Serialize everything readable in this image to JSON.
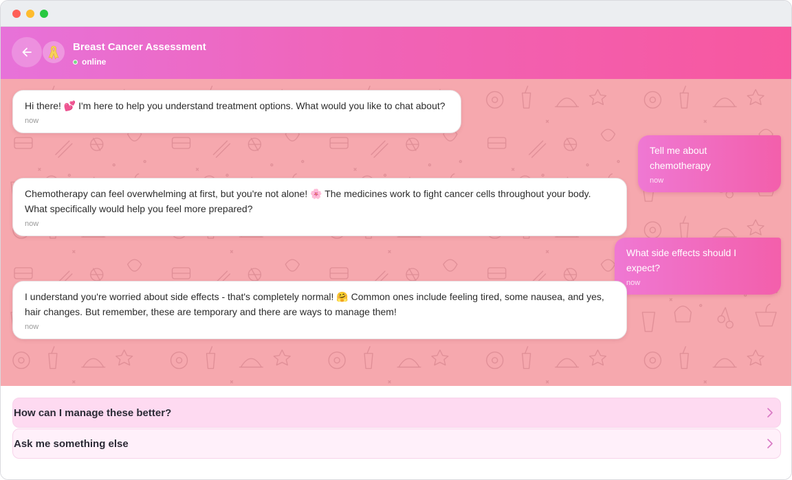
{
  "header": {
    "title": "Breast Cancer Assessment",
    "status": "online",
    "back_icon": "arrow-left-icon",
    "avatar_icon": "awareness-ribbon-icon"
  },
  "messages": [
    {
      "sender": "bot",
      "text": "Hi there! 💕 I'm here to help you understand treatment options. What would you like to chat about?",
      "time": "now"
    },
    {
      "sender": "user",
      "text": "Tell me about chemotherapy",
      "time": "now"
    },
    {
      "sender": "bot",
      "text": "Chemotherapy can feel overwhelming at first, but you're not alone! 🌸 The medicines work to fight cancer cells throughout your body. What specifically would help you feel more prepared?",
      "time": "now"
    },
    {
      "sender": "user",
      "text": "What side effects should I expect?",
      "time": "now"
    },
    {
      "sender": "bot",
      "text": "I understand you're worried about side effects - that's completely normal! 🤗 Common ones include feeling tired, some nausea, and yes, hair changes. But remember, these are temporary and there are ways to manage them!",
      "time": "now"
    }
  ],
  "quick_replies": [
    {
      "label": "How can I manage these better?",
      "icon": "chevron-right-icon"
    },
    {
      "label": "Ask me something else",
      "icon": "chevron-right-icon"
    }
  ],
  "colors": {
    "header_start": "#e772d9",
    "header_end": "#f7579f",
    "chat_background": "#f6a8ae",
    "user_bubble": "#f35fab"
  }
}
